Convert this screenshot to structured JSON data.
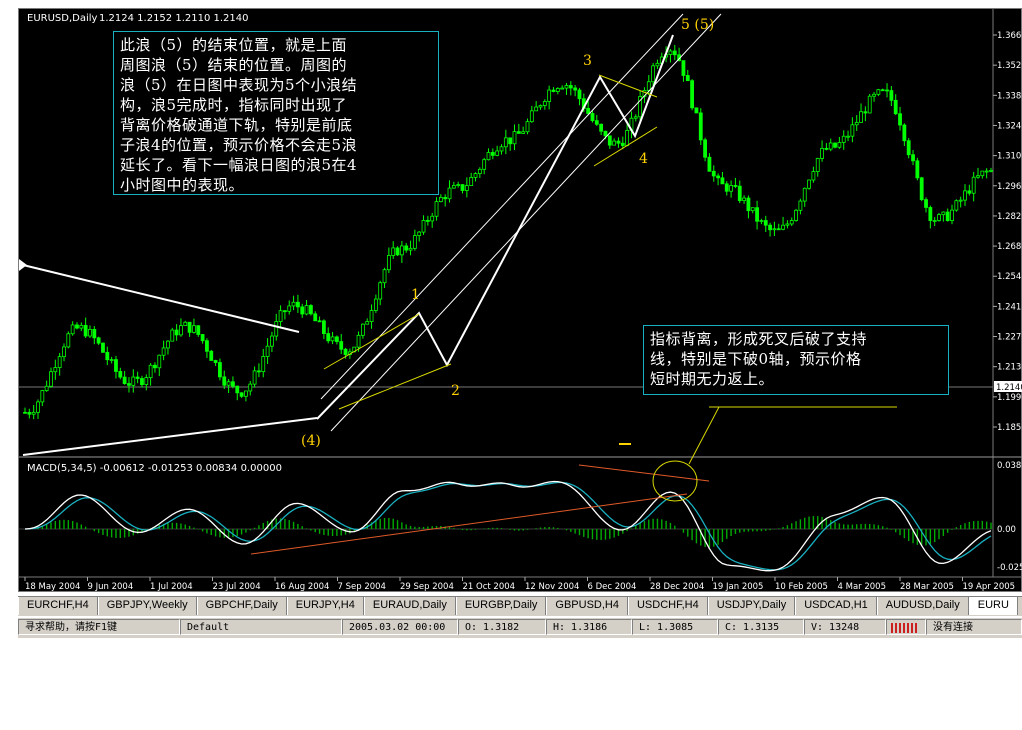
{
  "window": {
    "symbol_title": "EURUSD,Daily",
    "ohlc": "1.2124 1.2152 1.2110 1.2140"
  },
  "annotations": {
    "note1_lines": [
      "此浪（5）的结束位置，就是上面",
      "周图浪（5）结束的位置。周图的",
      "浪（5）在日图中表现为5个小浪结",
      "构，浪5完成时，指标同时出现了",
      "背离价格破通道下轨，特别是前底",
      "子浪4的位置，预示价格不会走5浪",
      "延长了。看下一幅浪日图的浪5在4",
      "小时图中的表现。"
    ],
    "note2_lines": [
      "指标背离，形成死叉后破了支持",
      "线，特别是下破0轴，预示价格",
      "短时期无力返上。"
    ],
    "wave_labels": {
      "w4_paren": "(4)",
      "w1": "1",
      "w2": "2",
      "w3": "3",
      "w4": "4",
      "w5": "5 (5)"
    }
  },
  "price_axis": {
    "ticks": [
      "1.3660",
      "1.3520",
      "1.3380",
      "1.3240",
      "1.3105",
      "1.2965",
      "1.2825",
      "1.2685",
      "1.2545",
      "1.2410",
      "1.2270",
      "1.2130",
      "1.1990",
      "1.1850"
    ],
    "current_price": "1.2140"
  },
  "macd": {
    "title": "MACD(5,34,5) -0.00612 -0.01253 0.00834 0.00000",
    "ticks": [
      "0.0389",
      "0.00",
      "-0.025"
    ]
  },
  "date_axis": [
    "18 May 2004",
    "9 Jun 2004",
    "1 Jul 2004",
    "23 Jul 2004",
    "16 Aug 2004",
    "7 Sep 2004",
    "29 Sep 2004",
    "21 Oct 2004",
    "12 Nov 2004",
    "6 Dec 2004",
    "28 Dec 2004",
    "19 Jan 2005",
    "10 Feb 2005",
    "4 Mar 2005",
    "28 Mar 2005",
    "19 Apr 2005"
  ],
  "tabs": [
    "EURCHF,H4",
    "GBPJPY,Weekly",
    "GBPCHF,Daily",
    "EURJPY,H4",
    "EURAUD,Daily",
    "EURGBP,Daily",
    "GBPUSD,H4",
    "USDCHF,H4",
    "USDJPY,Daily",
    "USDCAD,H1",
    "AUDUSD,Daily",
    "EURU"
  ],
  "status": {
    "help": "寻求帮助，请按F1键",
    "profile": "Default",
    "datetime": "2005.03.02 00:00",
    "open_label": "O:",
    "open": "1.3182",
    "high_label": "H:",
    "high": "1.3186",
    "low_label": "L:",
    "low": "1.3085",
    "close_label": "C:",
    "close": "1.3135",
    "volume_label": "V:",
    "volume": "13248",
    "connection": "没有连接"
  },
  "colors": {
    "background": "#000000",
    "candles": "#00ff00",
    "wave_labels": "#ffd200",
    "channel_lines": "#ffffff",
    "yellow_lines": "#d8d800",
    "macd_main": "#ffffff",
    "macd_signal": "#19b0c0",
    "macd_hist": "#00aa00",
    "divergence_line": "#e05a28",
    "note_border": "#19b0c0"
  },
  "chart_data": {
    "type": "candlestick",
    "series_note": "EURUSD daily closes (approximate key points read from chart)",
    "key_points": [
      {
        "x": "18 May 2004",
        "y": 1.192
      },
      {
        "x": "1 Jul 2004",
        "y": 1.232
      },
      {
        "x": "23 Jul 2004",
        "y": 1.206
      },
      {
        "x": "10 Aug 2004",
        "y": 1.233
      },
      {
        "x": "24 Aug 2004",
        "y": 1.202
      },
      {
        "x": "29 Sep 2004",
        "y": 1.243
      },
      {
        "x": "7 Oct 2004",
        "y": 1.222
      },
      {
        "x": "21 Oct 2004",
        "y": 1.27
      },
      {
        "x": "12 Nov 2004",
        "y": 1.298
      },
      {
        "x": "24 Nov 2004",
        "y": 1.322
      },
      {
        "x": "6 Dec 2004",
        "y": 1.349
      },
      {
        "x": "14 Dec 2004",
        "y": 1.32
      },
      {
        "x": "30 Dec 2004",
        "y": 1.366
      },
      {
        "x": "19 Jan 2005",
        "y": 1.3
      },
      {
        "x": "10 Feb 2005",
        "y": 1.278
      },
      {
        "x": "4 Mar 2005",
        "y": 1.318
      },
      {
        "x": "14 Mar 2005",
        "y": 1.344
      },
      {
        "x": "28 Mar 2005",
        "y": 1.284
      },
      {
        "x": "19 Apr 2005",
        "y": 1.307
      }
    ],
    "ylim": [
      1.185,
      1.372
    ]
  }
}
